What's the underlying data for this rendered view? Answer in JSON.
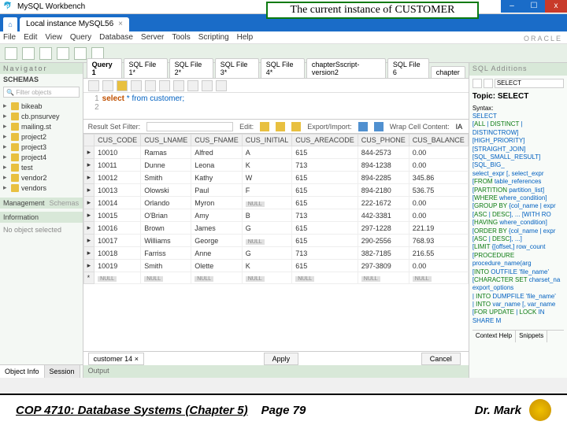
{
  "app_title": "MySQL Workbench",
  "callout_text": "The current instance of CUSTOMER",
  "main_tab": "Local instance MySQL56",
  "menus": [
    "File",
    "Edit",
    "View",
    "Query",
    "Database",
    "Server",
    "Tools",
    "Scripting",
    "Help"
  ],
  "brand": "ORACLE",
  "nav": {
    "header": "Navigator",
    "schemas_label": "SCHEMAS",
    "filter_placeholder": "Filter objects",
    "items": [
      "bikeab",
      "cb.pnsurvey",
      "mailing.st",
      "project2",
      "project3",
      "project4",
      "test",
      "vendor2",
      "vendors"
    ],
    "mgmt_label": "Management",
    "schemas_tab": "Schemas",
    "info_label": "Information",
    "no_object": "No object selected",
    "bottom_tabs": [
      "Object Info",
      "Session"
    ]
  },
  "sql_tabs": [
    "Query 1",
    "SQL File 1*",
    "SQL File 2*",
    "SQL File 3*",
    "SQL File 4*",
    "chapterSscript-version2",
    "SQL File 6",
    "chapter"
  ],
  "editor": {
    "line1": "1",
    "line2": "2",
    "sql_select": "select",
    "sql_rest": " * from customer;"
  },
  "result": {
    "filter_label": "Result Set Filter:",
    "edit_label": "Edit:",
    "export_label": "Export/Import:",
    "wrap_label": "Wrap Cell Content:",
    "ia": "IA"
  },
  "columns": [
    "CUS_CODE",
    "CUS_LNAME",
    "CUS_FNAME",
    "CUS_INITIAL",
    "CUS_AREACODE",
    "CUS_PHONE",
    "CUS_BALANCE"
  ],
  "rows": [
    [
      "10010",
      "Ramas",
      "Alfred",
      "A",
      "615",
      "844-2573",
      "0.00"
    ],
    [
      "10011",
      "Dunne",
      "Leona",
      "K",
      "713",
      "894-1238",
      "0.00"
    ],
    [
      "10012",
      "Smith",
      "Kathy",
      "W",
      "615",
      "894-2285",
      "345.86"
    ],
    [
      "10013",
      "Olowski",
      "Paul",
      "F",
      "615",
      "894-2180",
      "536.75"
    ],
    [
      "10014",
      "Orlando",
      "Myron",
      "",
      "615",
      "222-1672",
      "0.00"
    ],
    [
      "10015",
      "O'Brian",
      "Amy",
      "B",
      "713",
      "442-3381",
      "0.00"
    ],
    [
      "10016",
      "Brown",
      "James",
      "G",
      "615",
      "297-1228",
      "221.19"
    ],
    [
      "10017",
      "Williams",
      "George",
      "",
      "615",
      "290-2556",
      "768.93"
    ],
    [
      "10018",
      "Farriss",
      "Anne",
      "G",
      "713",
      "382-7185",
      "216.55"
    ],
    [
      "10019",
      "Smith",
      "Olette",
      "K",
      "615",
      "297-3809",
      "0.00"
    ]
  ],
  "null_label": "NULL",
  "result_tab": "customer 14",
  "apply": "Apply",
  "cancel": "Cancel",
  "output_label": "Output",
  "help": {
    "header": "SQL Additions",
    "select_label": "SELECT",
    "topic_label": "Topic:",
    "topic_value": "SELECT",
    "syntax_label": "Syntax:",
    "syntax_select": "SELECT",
    "body_lines": [
      "[ALL | DISTINCT | DISTINCTROW]",
      "[HIGH_PRIORITY]",
      "[STRAIGHT_JOIN]",
      "[SQL_SMALL_RESULT] [SQL_BIG_",
      "select_expr [, select_expr",
      "[FROM table_references",
      "[PARTITION partition_list]",
      "[WHERE where_condition]",
      "[GROUP BY {col_name | expr",
      "  [ASC | DESC], ... [WITH RO",
      "[HAVING where_condition]",
      "[ORDER BY {col_name | expr",
      "  [ASC | DESC], ...]",
      "[LIMIT {[offset,] row_count",
      "[PROCEDURE procedure_name(arg",
      "[INTO OUTFILE 'file_name'",
      "  [CHARACTER SET charset_na",
      "  export_options",
      " | INTO DUMPFILE 'file_name'",
      " | INTO var_name [, var_name",
      "[FOR UPDATE | LOCK IN SHARE M"
    ],
    "tabs": [
      "Context Help",
      "Snippets"
    ]
  },
  "footer": {
    "left": "COP 4710: Database Systems  (Chapter 5)",
    "mid": "Page 79",
    "right": "Dr. Mark"
  }
}
